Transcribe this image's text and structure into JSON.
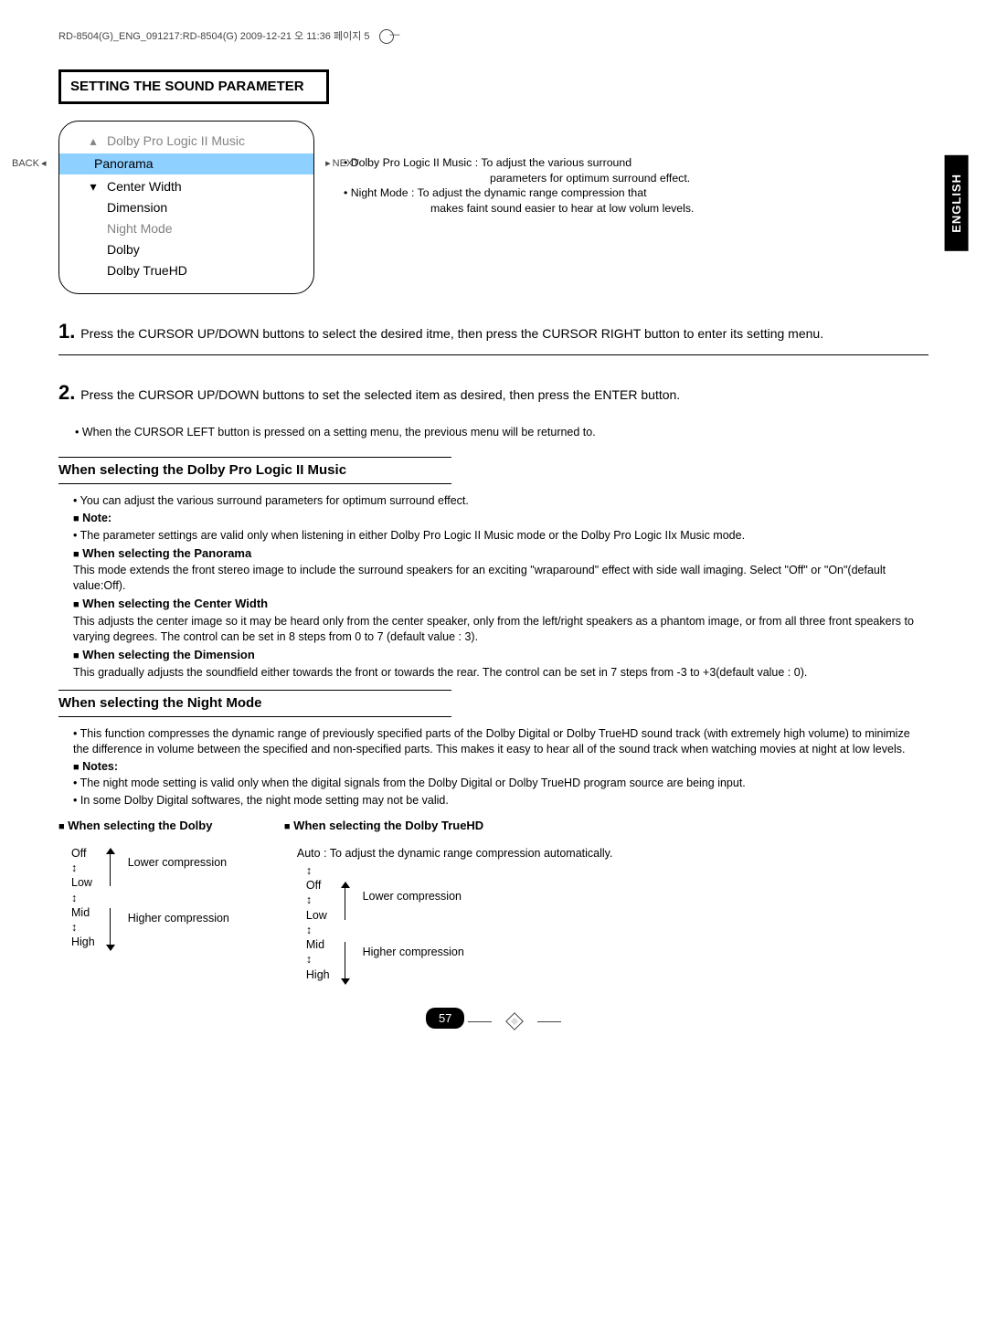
{
  "crop_mark": "RD-8504(G)_ENG_091217:RD-8504(G)  2009-12-21  오   11:36  페이지 5",
  "section_title": "SETTING THE SOUND PARAMETER",
  "language_tab": "ENGLISH",
  "menu": {
    "back": "BACK",
    "next": "NEXT",
    "items": [
      "Dolby Pro Logic II Music",
      "Panorama",
      "Center Width",
      "Dimension",
      "Night Mode",
      "Dolby",
      "Dolby TrueHD"
    ]
  },
  "top_notes": {
    "l1": "• Dolby Pro Logic II Music : To adjust the various surround",
    "l1b": "parameters for optimum surround effect.",
    "l2": "• Night Mode : To adjust the dynamic range compression that",
    "l2b": "makes faint sound easier to hear at low volum levels."
  },
  "steps": {
    "s1": "Press the CURSOR UP/DOWN buttons to select the desired itme, then press the CURSOR RIGHT button to enter its setting menu.",
    "s2": "Press the CURSOR UP/DOWN buttons to set the selected item as desired, then press the ENTER button.",
    "s2_sub": "• When the CURSOR LEFT button is pressed on a setting menu, the previous menu will be returned to."
  },
  "dolby_music": {
    "heading": "When selecting the Dolby Pro Logic II  Music",
    "b1": "• You can adjust the various surround parameters for optimum surround effect.",
    "note_label": "Note:",
    "b2": "• The parameter settings are valid only when listening in either Dolby Pro Logic II Music mode or the Dolby Pro Logic IIx Music mode.",
    "pan_t": "When selecting the Panorama",
    "pan_txt": "This mode extends the front stereo image to include the surround speakers for an exciting \"wraparound\" effect with side wall imaging. Select \"Off\" or \"On\"(default value:Off).",
    "cw_t": "When selecting the Center Width",
    "cw_txt": "This adjusts the center image so it may be heard only from the center speaker, only from the left/right speakers as a phantom image, or from all three front speakers to varying degrees. The control can be set in 8 steps from 0 to 7 (default value : 3).",
    "dim_t": "When selecting the Dimension",
    "dim_txt": "This gradually adjusts the soundfield either towards the front or towards the rear. The control can be set in 7 steps from -3 to +3(default value : 0)."
  },
  "night": {
    "heading": "When selecting the Night Mode",
    "b1": "• This function compresses the dynamic range of previously specified parts of the Dolby Digital or Dolby TrueHD sound track (with extremely high volume) to minimize the difference in volume between the specified and non-specified parts. This makes it easy to hear all of the sound track when watching movies at night at low levels.",
    "notes_label": "Notes:",
    "b2": "• The night mode setting is valid only when the digital signals from the Dolby Digital or Dolby TrueHD program source are being input.",
    "b3": "• In some Dolby Digital softwares, the night mode setting may not be valid."
  },
  "dolby_select": {
    "t1": "When selecting the Dolby",
    "t2": "When selecting the Dolby TrueHD",
    "auto_line": "Auto : To adjust the dynamic range compression automatically.",
    "off": "Off",
    "low": "Low",
    "mid": "Mid",
    "high": "High",
    "ud": "↕",
    "lower": "Lower compression",
    "higher": "Higher compression"
  },
  "page_num": "57"
}
